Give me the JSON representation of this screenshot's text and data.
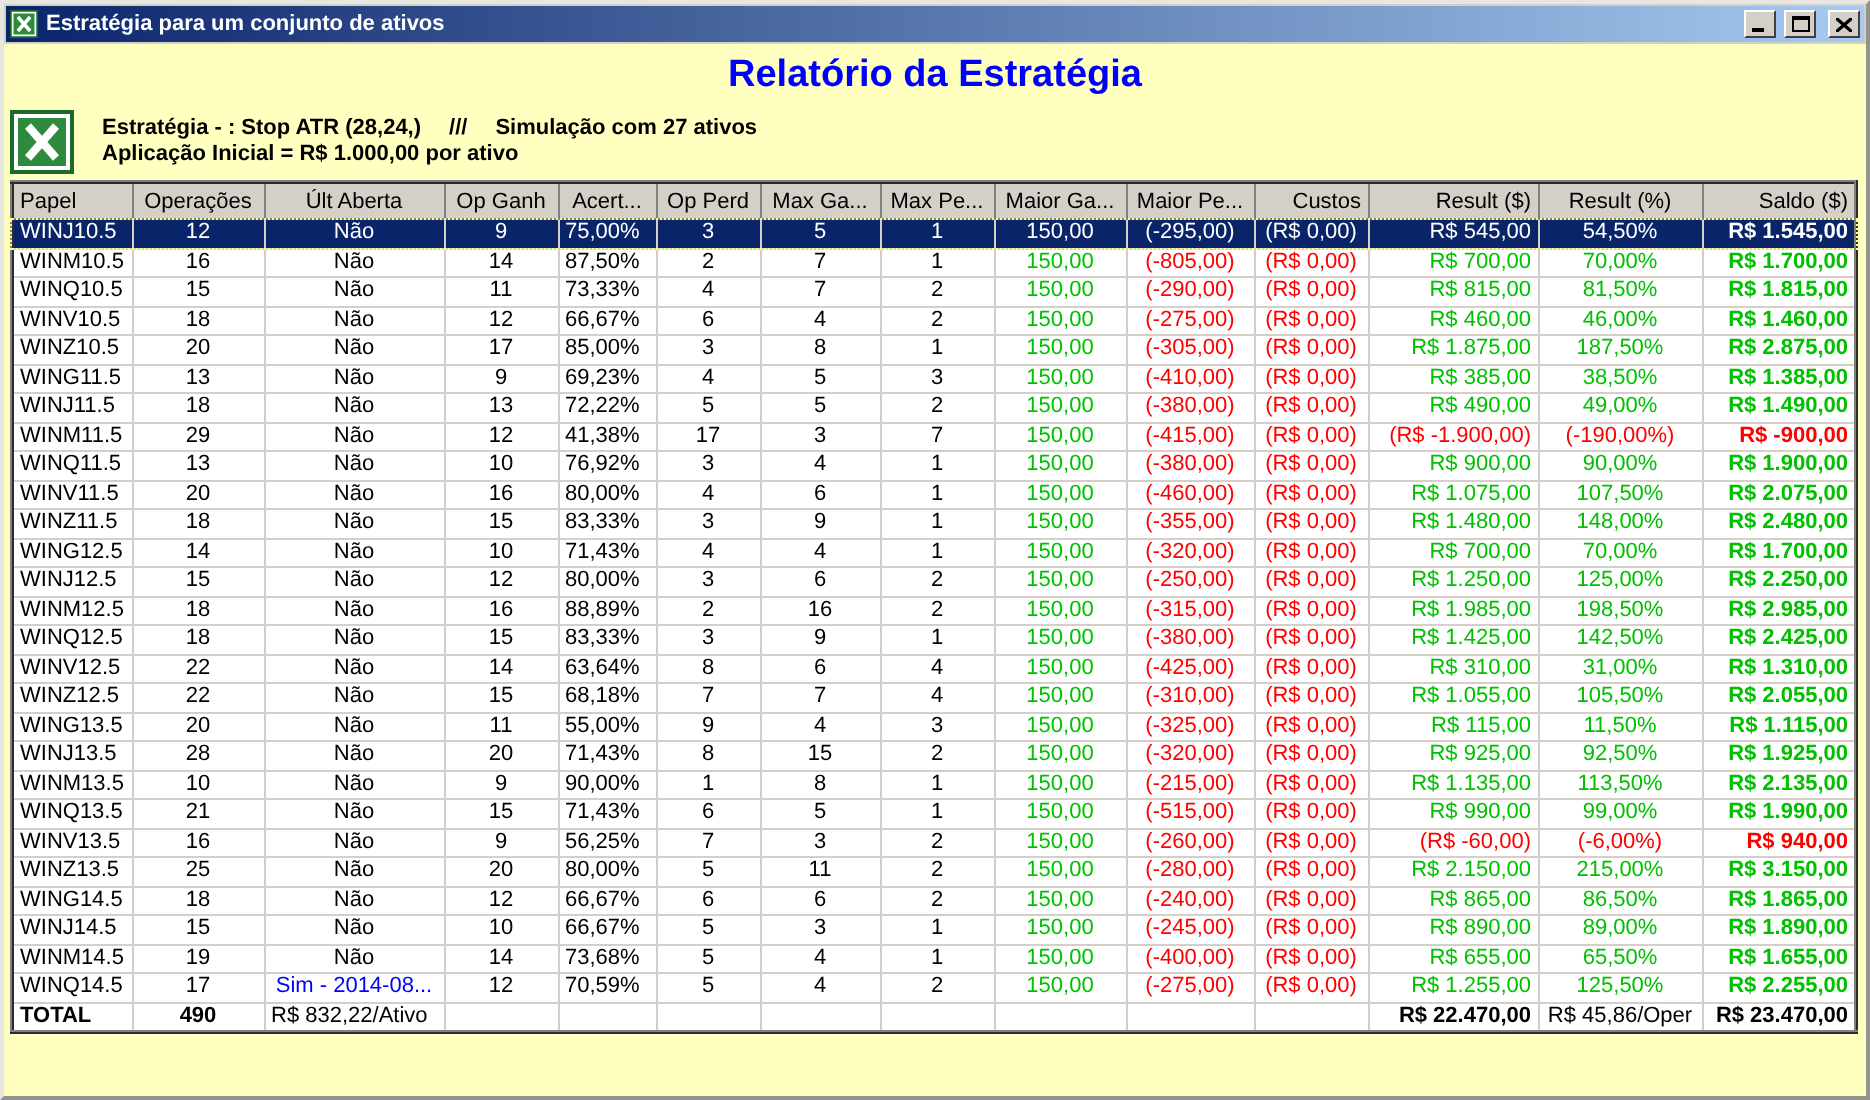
{
  "window": {
    "title": "Estratégia para um conjunto de ativos"
  },
  "report_title": "Relatório da Estratégia",
  "info": {
    "strategy": "Estratégia - : Stop ATR (28,24,)",
    "separator": "///",
    "simulation": "Simulação com 27 ativos",
    "initial": "Aplicação Inicial = R$ 1.000,00 por ativo"
  },
  "columns": [
    {
      "label": "Papel",
      "kind": "label"
    },
    {
      "label": "Operações",
      "kind": "count"
    },
    {
      "label": "Últ Aberta",
      "kind": "open"
    },
    {
      "label": "Op Ganh",
      "kind": "count"
    },
    {
      "label": "Acert...",
      "kind": "ratio"
    },
    {
      "label": "Op Perd",
      "kind": "count"
    },
    {
      "label": "Max Ga...",
      "kind": "count"
    },
    {
      "label": "Max Pe...",
      "kind": "count"
    },
    {
      "label": "Maior Ga...",
      "kind": "gain"
    },
    {
      "label": "Maior Pe...",
      "kind": "loss"
    },
    {
      "label": "Custos",
      "kind": "loss"
    },
    {
      "label": "Result ($)",
      "kind": "money"
    },
    {
      "label": "Result (%)",
      "kind": "percent"
    },
    {
      "label": "Saldo ($)",
      "kind": "balance"
    }
  ],
  "rows": [
    {
      "cells": [
        "WINJ10.5",
        "12",
        "Não",
        "9",
        "75,00%",
        "3",
        "5",
        "1",
        "150,00",
        "(-295,00)",
        "(R$ 0,00)",
        "R$ 545,00",
        "54,50%",
        "R$ 1.545,00"
      ],
      "open": false,
      "loss": false,
      "selected": true
    },
    {
      "cells": [
        "WINM10.5",
        "16",
        "Não",
        "14",
        "87,50%",
        "2",
        "7",
        "1",
        "150,00",
        "(-805,00)",
        "(R$ 0,00)",
        "R$ 700,00",
        "70,00%",
        "R$ 1.700,00"
      ],
      "open": false,
      "loss": false,
      "selected": false
    },
    {
      "cells": [
        "WINQ10.5",
        "15",
        "Não",
        "11",
        "73,33%",
        "4",
        "7",
        "2",
        "150,00",
        "(-290,00)",
        "(R$ 0,00)",
        "R$ 815,00",
        "81,50%",
        "R$ 1.815,00"
      ],
      "open": false,
      "loss": false,
      "selected": false
    },
    {
      "cells": [
        "WINV10.5",
        "18",
        "Não",
        "12",
        "66,67%",
        "6",
        "4",
        "2",
        "150,00",
        "(-275,00)",
        "(R$ 0,00)",
        "R$ 460,00",
        "46,00%",
        "R$ 1.460,00"
      ],
      "open": false,
      "loss": false,
      "selected": false
    },
    {
      "cells": [
        "WINZ10.5",
        "20",
        "Não",
        "17",
        "85,00%",
        "3",
        "8",
        "1",
        "150,00",
        "(-305,00)",
        "(R$ 0,00)",
        "R$ 1.875,00",
        "187,50%",
        "R$ 2.875,00"
      ],
      "open": false,
      "loss": false,
      "selected": false
    },
    {
      "cells": [
        "WING11.5",
        "13",
        "Não",
        "9",
        "69,23%",
        "4",
        "5",
        "3",
        "150,00",
        "(-410,00)",
        "(R$ 0,00)",
        "R$ 385,00",
        "38,50%",
        "R$ 1.385,00"
      ],
      "open": false,
      "loss": false,
      "selected": false
    },
    {
      "cells": [
        "WINJ11.5",
        "18",
        "Não",
        "13",
        "72,22%",
        "5",
        "5",
        "2",
        "150,00",
        "(-380,00)",
        "(R$ 0,00)",
        "R$ 490,00",
        "49,00%",
        "R$ 1.490,00"
      ],
      "open": false,
      "loss": false,
      "selected": false
    },
    {
      "cells": [
        "WINM11.5",
        "29",
        "Não",
        "12",
        "41,38%",
        "17",
        "3",
        "7",
        "150,00",
        "(-415,00)",
        "(R$ 0,00)",
        "(R$ -1.900,00)",
        "(-190,00%)",
        "R$ -900,00"
      ],
      "open": false,
      "loss": true,
      "selected": false
    },
    {
      "cells": [
        "WINQ11.5",
        "13",
        "Não",
        "10",
        "76,92%",
        "3",
        "4",
        "1",
        "150,00",
        "(-380,00)",
        "(R$ 0,00)",
        "R$ 900,00",
        "90,00%",
        "R$ 1.900,00"
      ],
      "open": false,
      "loss": false,
      "selected": false
    },
    {
      "cells": [
        "WINV11.5",
        "20",
        "Não",
        "16",
        "80,00%",
        "4",
        "6",
        "1",
        "150,00",
        "(-460,00)",
        "(R$ 0,00)",
        "R$ 1.075,00",
        "107,50%",
        "R$ 2.075,00"
      ],
      "open": false,
      "loss": false,
      "selected": false
    },
    {
      "cells": [
        "WINZ11.5",
        "18",
        "Não",
        "15",
        "83,33%",
        "3",
        "9",
        "1",
        "150,00",
        "(-355,00)",
        "(R$ 0,00)",
        "R$ 1.480,00",
        "148,00%",
        "R$ 2.480,00"
      ],
      "open": false,
      "loss": false,
      "selected": false
    },
    {
      "cells": [
        "WING12.5",
        "14",
        "Não",
        "10",
        "71,43%",
        "4",
        "4",
        "1",
        "150,00",
        "(-320,00)",
        "(R$ 0,00)",
        "R$ 700,00",
        "70,00%",
        "R$ 1.700,00"
      ],
      "open": false,
      "loss": false,
      "selected": false
    },
    {
      "cells": [
        "WINJ12.5",
        "15",
        "Não",
        "12",
        "80,00%",
        "3",
        "6",
        "2",
        "150,00",
        "(-250,00)",
        "(R$ 0,00)",
        "R$ 1.250,00",
        "125,00%",
        "R$ 2.250,00"
      ],
      "open": false,
      "loss": false,
      "selected": false
    },
    {
      "cells": [
        "WINM12.5",
        "18",
        "Não",
        "16",
        "88,89%",
        "2",
        "16",
        "2",
        "150,00",
        "(-315,00)",
        "(R$ 0,00)",
        "R$ 1.985,00",
        "198,50%",
        "R$ 2.985,00"
      ],
      "open": false,
      "loss": false,
      "selected": false
    },
    {
      "cells": [
        "WINQ12.5",
        "18",
        "Não",
        "15",
        "83,33%",
        "3",
        "9",
        "1",
        "150,00",
        "(-380,00)",
        "(R$ 0,00)",
        "R$ 1.425,00",
        "142,50%",
        "R$ 2.425,00"
      ],
      "open": false,
      "loss": false,
      "selected": false
    },
    {
      "cells": [
        "WINV12.5",
        "22",
        "Não",
        "14",
        "63,64%",
        "8",
        "6",
        "4",
        "150,00",
        "(-425,00)",
        "(R$ 0,00)",
        "R$ 310,00",
        "31,00%",
        "R$ 1.310,00"
      ],
      "open": false,
      "loss": false,
      "selected": false
    },
    {
      "cells": [
        "WINZ12.5",
        "22",
        "Não",
        "15",
        "68,18%",
        "7",
        "7",
        "4",
        "150,00",
        "(-310,00)",
        "(R$ 0,00)",
        "R$ 1.055,00",
        "105,50%",
        "R$ 2.055,00"
      ],
      "open": false,
      "loss": false,
      "selected": false
    },
    {
      "cells": [
        "WING13.5",
        "20",
        "Não",
        "11",
        "55,00%",
        "9",
        "4",
        "3",
        "150,00",
        "(-325,00)",
        "(R$ 0,00)",
        "R$ 115,00",
        "11,50%",
        "R$ 1.115,00"
      ],
      "open": false,
      "loss": false,
      "selected": false
    },
    {
      "cells": [
        "WINJ13.5",
        "28",
        "Não",
        "20",
        "71,43%",
        "8",
        "15",
        "2",
        "150,00",
        "(-320,00)",
        "(R$ 0,00)",
        "R$ 925,00",
        "92,50%",
        "R$ 1.925,00"
      ],
      "open": false,
      "loss": false,
      "selected": false
    },
    {
      "cells": [
        "WINM13.5",
        "10",
        "Não",
        "9",
        "90,00%",
        "1",
        "8",
        "1",
        "150,00",
        "(-215,00)",
        "(R$ 0,00)",
        "R$ 1.135,00",
        "113,50%",
        "R$ 2.135,00"
      ],
      "open": false,
      "loss": false,
      "selected": false
    },
    {
      "cells": [
        "WINQ13.5",
        "21",
        "Não",
        "15",
        "71,43%",
        "6",
        "5",
        "1",
        "150,00",
        "(-515,00)",
        "(R$ 0,00)",
        "R$ 990,00",
        "99,00%",
        "R$ 1.990,00"
      ],
      "open": false,
      "loss": false,
      "selected": false
    },
    {
      "cells": [
        "WINV13.5",
        "16",
        "Não",
        "9",
        "56,25%",
        "7",
        "3",
        "2",
        "150,00",
        "(-260,00)",
        "(R$ 0,00)",
        "(R$ -60,00)",
        "(-6,00%)",
        "R$ 940,00"
      ],
      "open": false,
      "loss": true,
      "selected": false
    },
    {
      "cells": [
        "WINZ13.5",
        "25",
        "Não",
        "20",
        "80,00%",
        "5",
        "11",
        "2",
        "150,00",
        "(-280,00)",
        "(R$ 0,00)",
        "R$ 2.150,00",
        "215,00%",
        "R$ 3.150,00"
      ],
      "open": false,
      "loss": false,
      "selected": false
    },
    {
      "cells": [
        "WING14.5",
        "18",
        "Não",
        "12",
        "66,67%",
        "6",
        "6",
        "2",
        "150,00",
        "(-240,00)",
        "(R$ 0,00)",
        "R$ 865,00",
        "86,50%",
        "R$ 1.865,00"
      ],
      "open": false,
      "loss": false,
      "selected": false
    },
    {
      "cells": [
        "WINJ14.5",
        "15",
        "Não",
        "10",
        "66,67%",
        "5",
        "3",
        "1",
        "150,00",
        "(-245,00)",
        "(R$ 0,00)",
        "R$ 890,00",
        "89,00%",
        "R$ 1.890,00"
      ],
      "open": false,
      "loss": false,
      "selected": false
    },
    {
      "cells": [
        "WINM14.5",
        "19",
        "Não",
        "14",
        "73,68%",
        "5",
        "4",
        "1",
        "150,00",
        "(-400,00)",
        "(R$ 0,00)",
        "R$ 655,00",
        "65,50%",
        "R$ 1.655,00"
      ],
      "open": false,
      "loss": false,
      "selected": false
    },
    {
      "cells": [
        "WINQ14.5",
        "17",
        "Sim - 2014-08...",
        "12",
        "70,59%",
        "5",
        "4",
        "2",
        "150,00",
        "(-275,00)",
        "(R$ 0,00)",
        "R$ 1.255,00",
        "125,50%",
        "R$ 2.255,00"
      ],
      "open": true,
      "loss": false,
      "selected": false
    }
  ],
  "total_row": [
    {
      "text": "TOTAL",
      "bold": true
    },
    {
      "text": "490",
      "bold": true
    },
    {
      "text": "R$ 832,22/Ativo",
      "bold": false
    },
    {
      "text": "R$ 22.470,00",
      "bold": true
    },
    {
      "text": "R$ 45,86/Oper",
      "bold": false
    },
    {
      "text": "R$ 23.470,00",
      "bold": true
    }
  ]
}
